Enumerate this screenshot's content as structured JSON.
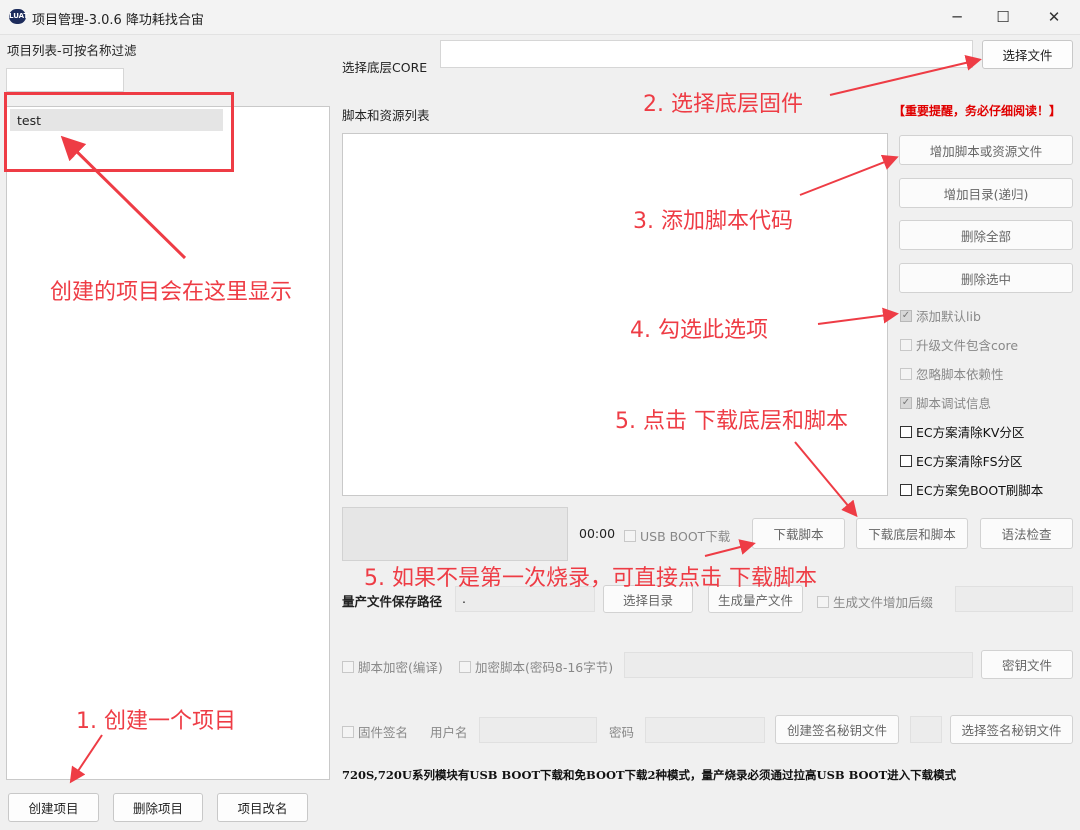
{
  "window": {
    "title": "项目管理-3.0.6 降功耗找合宙",
    "icon_text": "LUAT",
    "minimize_glyph": "─",
    "maximize_glyph": "☐",
    "close_glyph": "✕"
  },
  "left": {
    "header": "项目列表-可按名称过滤",
    "filter_value": "",
    "projects": [
      "test"
    ],
    "buttons": {
      "create": "创建项目",
      "delete": "删除项目",
      "rename": "项目改名"
    }
  },
  "core": {
    "label": "选择底层CORE",
    "value": "",
    "select_button": "选择文件"
  },
  "scripts": {
    "label": "脚本和资源列表",
    "warning": "【重要提醒，务必仔细阅读！】",
    "buttons": {
      "add_files": "增加脚本或资源文件",
      "add_dir": "增加目录(递归)",
      "delete_all": "删除全部",
      "delete_selected": "删除选中"
    },
    "options": [
      {
        "label": "添加默认lib",
        "checked": true,
        "disabled": true
      },
      {
        "label": "升级文件包含core",
        "checked": false,
        "disabled": true
      },
      {
        "label": "忽略脚本依赖性",
        "checked": false,
        "disabled": true
      },
      {
        "label": "脚本调试信息",
        "checked": true,
        "disabled": true
      },
      {
        "label": "EC方案清除KV分区",
        "checked": false,
        "disabled": false
      },
      {
        "label": "EC方案清除FS分区",
        "checked": false,
        "disabled": false
      },
      {
        "label": "EC方案免BOOT刷脚本",
        "checked": false,
        "disabled": false
      }
    ]
  },
  "download": {
    "timer": "00:00",
    "usb_boot_label": "USB BOOT下载",
    "download_script": "下载脚本",
    "download_core_and_script": "下载底层和脚本",
    "syntax_check": "语法检查"
  },
  "production": {
    "label": "量产文件保存路径",
    "path_value": ".",
    "choose_dir": "选择目录",
    "generate": "生成量产文件",
    "suffix_label": "生成文件增加后缀",
    "suffix_value": ""
  },
  "encryption": {
    "encrypt_compile_label": "脚本加密(编译)",
    "encrypt_key_label": "加密脚本(密码8-16字节)",
    "key_value": "",
    "key_file_button": "密钥文件"
  },
  "signing": {
    "firmware_sign_label": "固件签名",
    "username_label": "用户名",
    "username_value": "",
    "password_label": "密码",
    "password_value": "",
    "create_key_button": "创建签名秘钥文件",
    "choose_key_button": "选择签名秘钥文件"
  },
  "footer_note": "720S,720U系列模块有USB BOOT下载和免BOOT下载2种模式，量产烧录必须通过拉高USB BOOT进入下载模式",
  "annotations": {
    "step1": "1. 创建一个项目",
    "step2": "2. 选择底层固件",
    "step3": "3. 添加脚本代码",
    "step4": "4. 勾选此选项",
    "step5a": "5. 点击 下载底层和脚本",
    "step5b": "5. 如果不是第一次烧录，可直接点击 下载脚本",
    "project_list_hint": "创建的项目会在这里显示"
  },
  "colors": {
    "annotation": "#ee3c45",
    "warning": "#e00000",
    "window_bg": "#f0f0f0"
  }
}
